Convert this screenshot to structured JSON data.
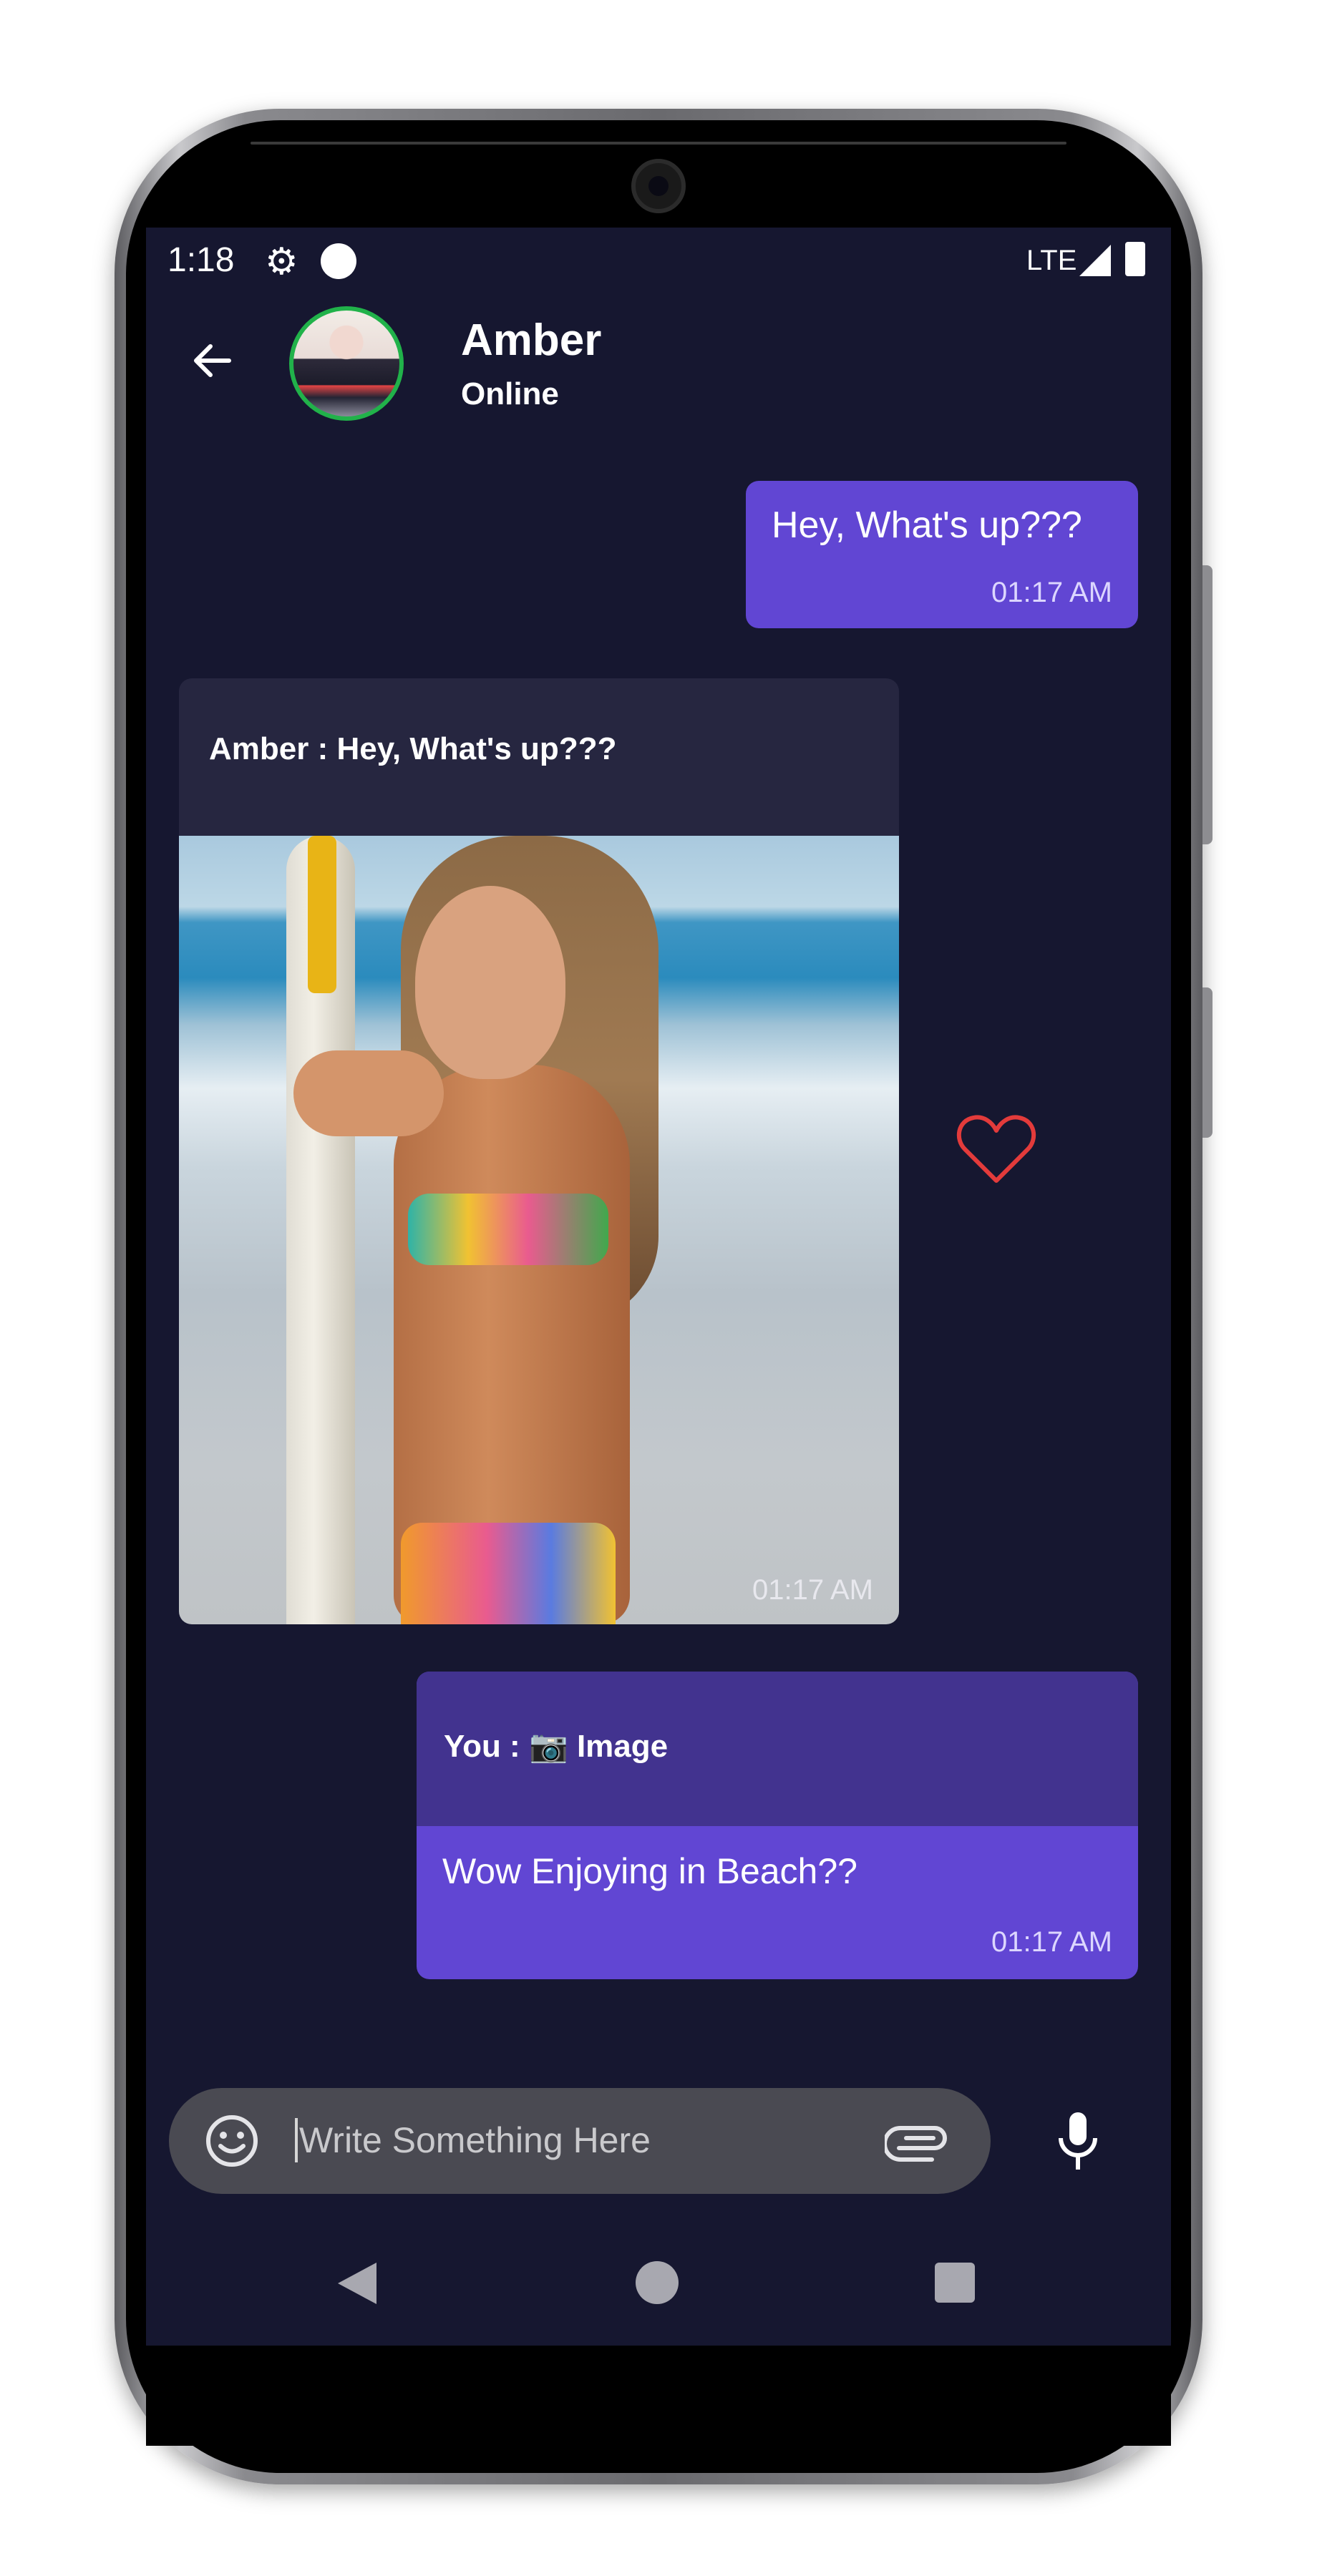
{
  "status_bar": {
    "time": "1:18",
    "network": "LTE",
    "icons": [
      "gear-icon",
      "circle-notification-icon",
      "signal-icon",
      "battery-icon"
    ]
  },
  "header": {
    "back_icon": "arrow-left-icon",
    "contact_name": "Amber",
    "contact_status": "Online"
  },
  "messages": [
    {
      "direction": "outgoing",
      "text": "Hey, What's up???",
      "time": "01:17 AM"
    },
    {
      "direction": "incoming",
      "reply_header": "Amber : Hey, What's up???",
      "attachment": "photo",
      "time": "01:17 AM"
    },
    {
      "direction": "outgoing",
      "reply_header": "You : 📷 Image",
      "text": "Wow Enjoying in Beach??",
      "time": "01:17 AM"
    }
  ],
  "reaction": {
    "icon": "heart-outline-icon"
  },
  "composer": {
    "placeholder": "Write Something Here",
    "left_icon": "emoji-icon",
    "attach_icon": "paperclip-icon",
    "mic_icon": "microphone-icon"
  },
  "navigation": [
    "back-triangle-icon",
    "home-circle-icon",
    "recents-square-icon"
  ],
  "colors": {
    "screen_bg": "#161730",
    "outgoing_bubble": "#6146d3",
    "outgoing_reply_header": "#42338f",
    "incoming_bubble": "#262640",
    "avatar_ring": "#21b24a",
    "heart": "#e33b3b",
    "input_bar": "#4a4a52"
  }
}
